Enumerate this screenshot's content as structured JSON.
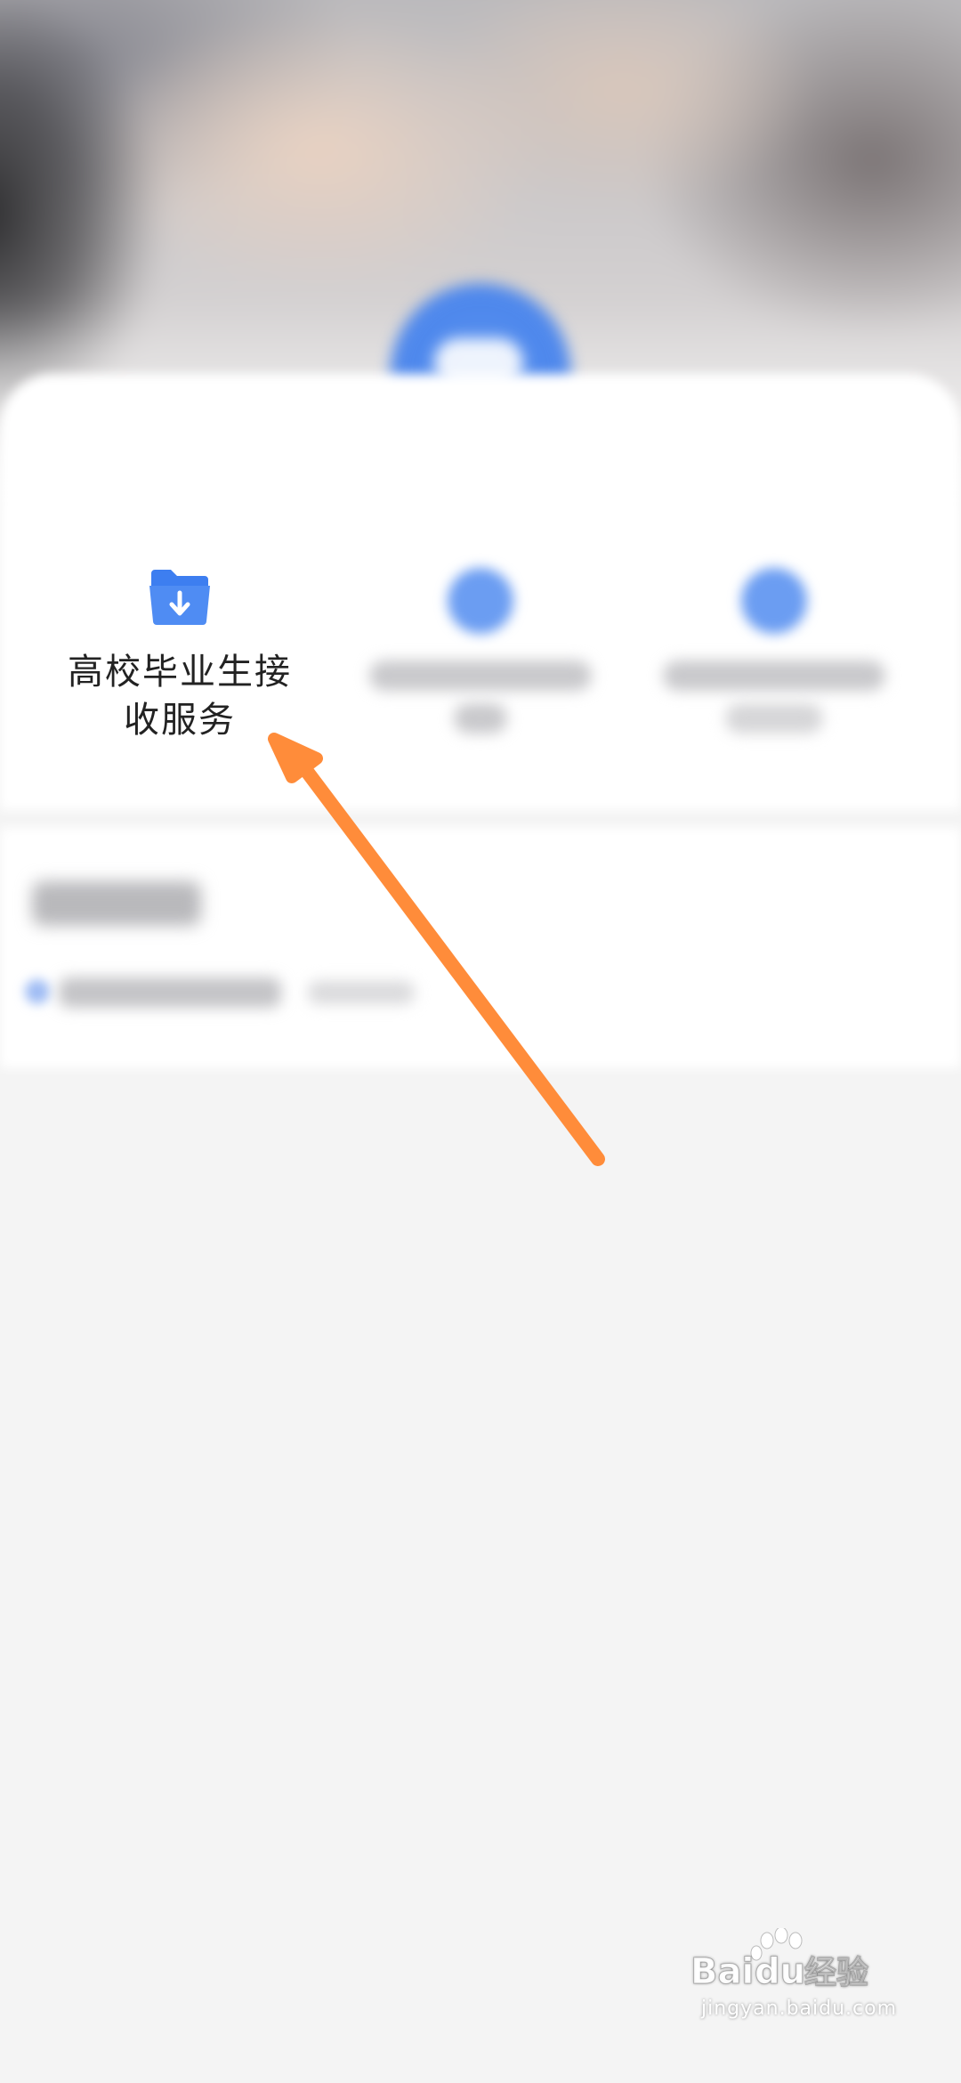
{
  "tiles": [
    {
      "id": "graduate-receive",
      "label_line1": "高校毕业生接",
      "label_line2": "收服务",
      "icon": "folder-download-icon",
      "accent": "#3d7ef0"
    }
  ],
  "annotation": {
    "arrow_color": "#ff8c3a"
  },
  "watermark": {
    "brand": "Baidu经验",
    "url": "jingyan.baidu.com"
  },
  "colors": {
    "background": "#f4f4f4",
    "card": "#ffffff",
    "accent_blue": "#3d7ef0"
  }
}
